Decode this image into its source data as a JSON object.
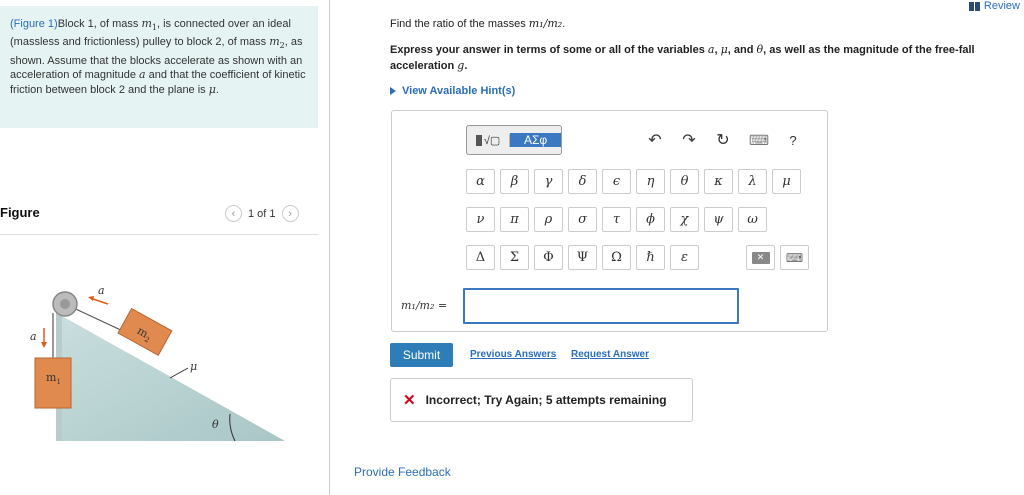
{
  "problem": {
    "figure_link": "(Figure 1)",
    "text_1": "Block 1, of mass ",
    "m1": "m",
    "m1_sub": "1",
    "text_2": ", is connected over an ideal (massless and frictionless) pulley to block 2, of mass ",
    "m2": "m",
    "m2_sub": "2",
    "text_3": ", as shown. Assume that the blocks accelerate as shown with an acceleration of magnitude ",
    "a": "a",
    "text_4": " and that the coefficient of kinetic friction between block 2 and the plane is ",
    "mu": "μ",
    "text_5": "."
  },
  "figure_panel": {
    "title": "Figure",
    "page": "1 of 1",
    "prev_icon": "chevron-left-icon",
    "next_icon": "chevron-right-icon",
    "labels": {
      "a_top": "a",
      "a_left": "a",
      "m2": "m",
      "m2_sub": "2",
      "m1": "m",
      "m1_sub": "1",
      "mu": "μ",
      "theta": "θ"
    }
  },
  "header": {
    "review": "Review"
  },
  "question": {
    "prompt_text": "Find the ratio of the masses ",
    "prompt_math": "m₁/m₂",
    "prompt_end": ".",
    "instr_1": "Express your answer in terms of some or all of the variables ",
    "instr_a": "a",
    "instr_sep1": ", ",
    "instr_mu": "μ",
    "instr_sep2": ", and ",
    "instr_theta": "θ",
    "instr_2": ", as well as the magnitude of the free-fall acceleration ",
    "instr_g": "g",
    "instr_end": ".",
    "hints": "View Available Hint(s)"
  },
  "toolbar": {
    "templates_label": "√▢",
    "symbols_label": "ΑΣφ",
    "undo": "↶",
    "redo": "↷",
    "reset": "↻",
    "keyboard": "⌨",
    "help": "?"
  },
  "symbols": {
    "row1": [
      "α",
      "β",
      "γ",
      "δ",
      "ϵ",
      "η",
      "θ",
      "κ",
      "λ",
      "μ"
    ],
    "row2": [
      "ν",
      "π",
      "ρ",
      "σ",
      "τ",
      "ϕ",
      "χ",
      "ψ",
      "ω"
    ],
    "row3": [
      "Δ",
      "Σ",
      "Φ",
      "Ψ",
      "Ω",
      "ℏ",
      "ε"
    ]
  },
  "answer": {
    "label": "m₁/m₂ =",
    "value": ""
  },
  "actions": {
    "submit": "Submit",
    "previous": "Previous Answers",
    "request": "Request Answer"
  },
  "feedback": {
    "message": "Incorrect; Try Again; 5 attempts remaining"
  },
  "footer": {
    "provide_feedback": "Provide Feedback"
  },
  "colors": {
    "accent": "#3a78c2",
    "link": "#2a6ebb",
    "error": "#d0021b",
    "panel_bg": "#e6f3f3",
    "block": "#e08a50"
  }
}
